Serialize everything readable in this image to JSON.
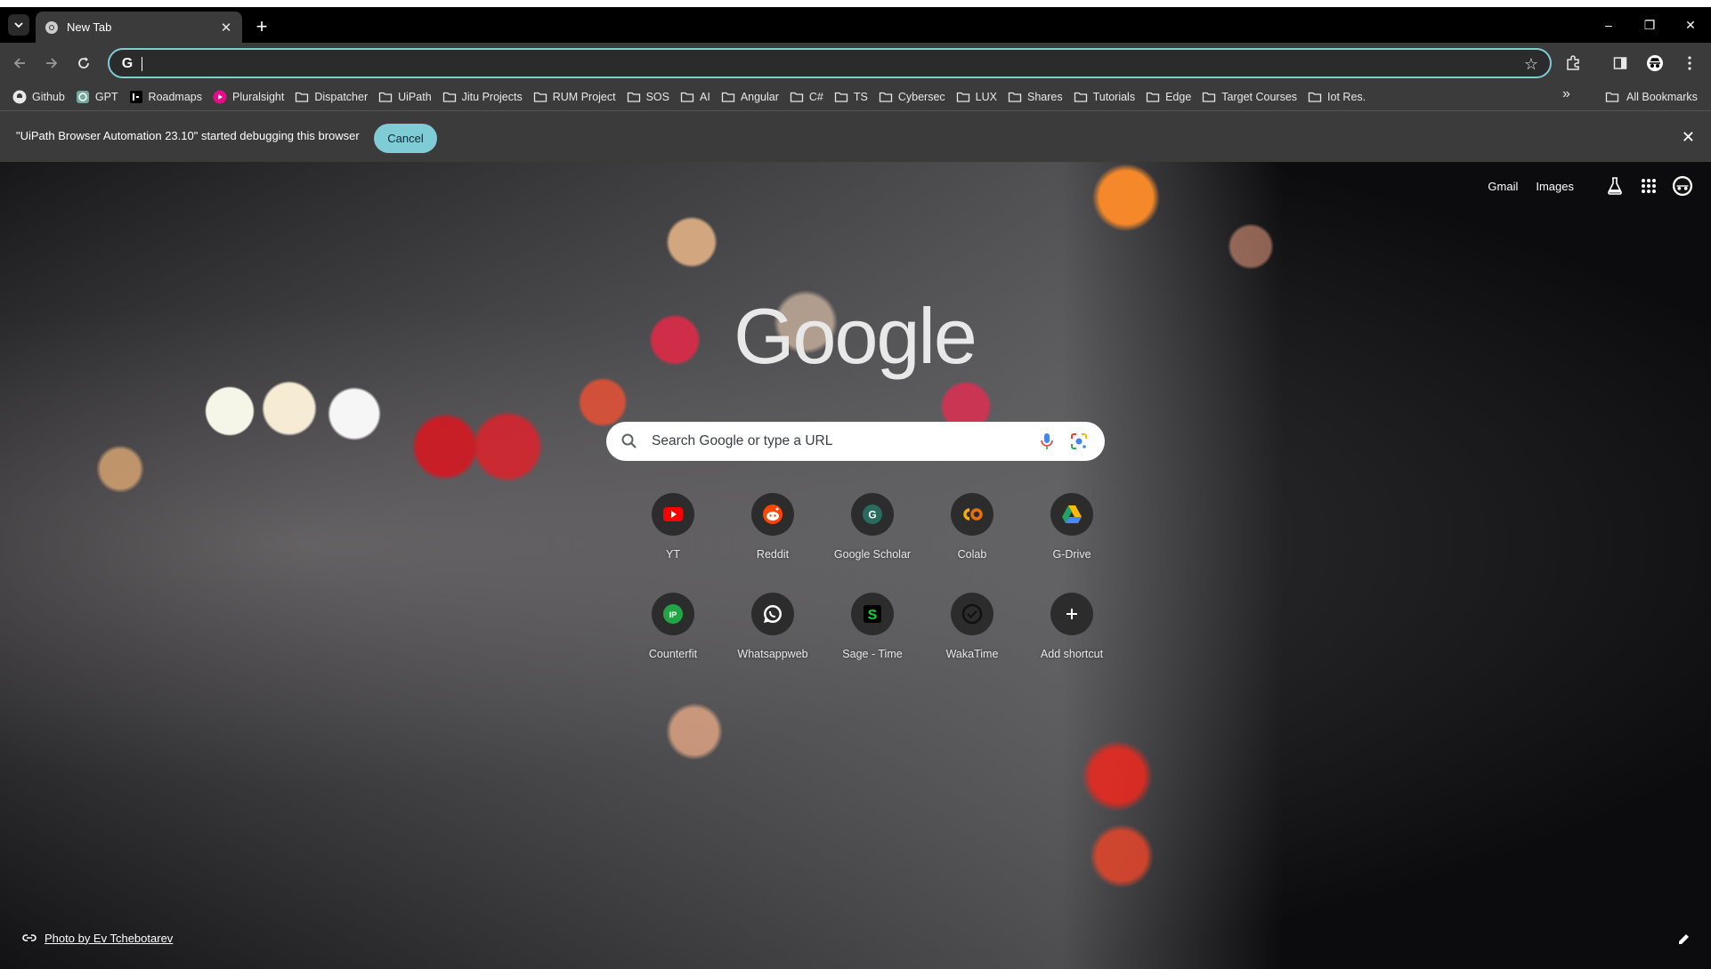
{
  "tab": {
    "title": "New Tab",
    "close_icon": "close-icon"
  },
  "window": {
    "minimize": "–",
    "restore": "❐",
    "close": "✕"
  },
  "omnibox": {
    "value": "",
    "prefix_icon": "G"
  },
  "bookmarks": [
    {
      "label": "Github",
      "icon": "github-icon"
    },
    {
      "label": "GPT",
      "icon": "openai-icon"
    },
    {
      "label": "Roadmaps",
      "icon": "roadmap-icon"
    },
    {
      "label": "Pluralsight",
      "icon": "pluralsight-icon"
    },
    {
      "label": "Dispatcher",
      "icon": "folder-icon"
    },
    {
      "label": "UiPath",
      "icon": "folder-icon"
    },
    {
      "label": "Jitu Projects",
      "icon": "folder-icon"
    },
    {
      "label": "RUM Project",
      "icon": "folder-icon"
    },
    {
      "label": "SOS",
      "icon": "folder-icon"
    },
    {
      "label": "AI",
      "icon": "folder-icon"
    },
    {
      "label": "Angular",
      "icon": "folder-icon"
    },
    {
      "label": "C#",
      "icon": "folder-icon"
    },
    {
      "label": "TS",
      "icon": "folder-icon"
    },
    {
      "label": "Cybersec",
      "icon": "folder-icon"
    },
    {
      "label": "LUX",
      "icon": "folder-icon"
    },
    {
      "label": "Shares",
      "icon": "folder-icon"
    },
    {
      "label": "Tutorials",
      "icon": "folder-icon"
    },
    {
      "label": "Edge",
      "icon": "folder-icon"
    },
    {
      "label": "Target Courses",
      "icon": "folder-icon"
    },
    {
      "label": "Iot Res.",
      "icon": "folder-icon"
    }
  ],
  "bookmarks_more": "»",
  "all_bookmarks": "All Bookmarks",
  "infobar": {
    "message": "\"UiPath Browser Automation 23.10\" started debugging this browser",
    "cancel_label": "Cancel"
  },
  "ntp": {
    "gmail": "Gmail",
    "images": "Images",
    "logo": "Google",
    "search_placeholder": "Search Google or type a URL",
    "shortcuts": [
      {
        "label": "YT",
        "icon": "youtube-icon",
        "color": "#ff0000"
      },
      {
        "label": "Reddit",
        "icon": "reddit-icon",
        "color": "#ff4500"
      },
      {
        "label": "Google Scholar",
        "icon": "scholar-icon",
        "color": "#2a6b5f"
      },
      {
        "label": "Colab",
        "icon": "colab-icon",
        "color": "#f9ab00"
      },
      {
        "label": "G-Drive",
        "icon": "drive-icon",
        "color": "#1fa463"
      },
      {
        "label": "Counterfit",
        "icon": "counterfit-icon",
        "color": "#23a447"
      },
      {
        "label": "Whatsappweb",
        "icon": "whatsapp-icon",
        "color": "#25d366"
      },
      {
        "label": "Sage - Time",
        "icon": "sage-icon",
        "color": "#00d639"
      },
      {
        "label": "WakaTime",
        "icon": "wakatime-icon",
        "color": "#000000"
      },
      {
        "label": "Add shortcut",
        "icon": "plus-icon",
        "color": "#ffffff"
      }
    ],
    "photo_credit": "Photo by Ev Tchebotarev"
  },
  "colors": {
    "accent": "#7fcbd6",
    "toolbar_bg": "#3b3b3b",
    "tabbar_bg": "#000000"
  }
}
